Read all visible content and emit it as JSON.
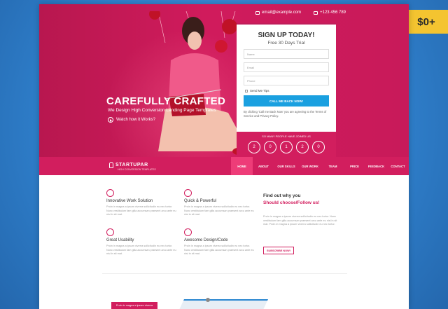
{
  "badge": {
    "price": "$0+",
    "color": "#f4c430"
  },
  "hero": {
    "email": "email@example.com",
    "phone": "+123 456 789",
    "title": "CAREFULLY CRAFTED",
    "subtitle": "We Design High Conversion Landing Page Templates",
    "watch": "Watch how it Works?",
    "accent": "#d21e5e"
  },
  "signup": {
    "title": "SIGN UP TODAY!",
    "subtitle": "Free 30 Days Trial",
    "name_placeholder": "Name",
    "email_placeholder": "Email",
    "phone_placeholder": "Phone",
    "checkbox_label": "Send Me Tips",
    "cta": "CALL ME BACK NOW!",
    "terms": "By clicking 'Call me Back Now' you are agreeing to the Terms of Service and Privacy Policy.",
    "joined_title": "SO MANY PEOPLE HAVE JOINED US",
    "counters": [
      "2",
      "0",
      "1",
      "2",
      "0"
    ]
  },
  "nav": {
    "logo": "STARTUPAR",
    "tagline": "HIGH CONVERSION TEMPLATES",
    "items": [
      "HOME",
      "ABOUT",
      "OUR SKILLS",
      "OUR WORK",
      "TEAM",
      "PRICE",
      "FEEDBACK",
      "CONTACT"
    ]
  },
  "features": {
    "items": [
      {
        "title": "Innovative Work Solution",
        "text": "Proin in magna a ipsum viverra sollicitudin eu nec tortor. Nunc vestibulum fam gilla accumsan praesent arcu ante eu nisi in sit mat."
      },
      {
        "title": "Quick & Powerful",
        "text": "Proin in magna a ipsum viverra sollicitudin eu nec tortor. Nunc vestibulum fam gilla accumsan praesent arcu ante eu nisi in sit mat."
      },
      {
        "title": "Great Usability",
        "text": "Proin in magna a ipsum viverra sollicitudin eu nec tortor. Nunc vestibulum fam gilla accumsan praesent arcu ante eu nisi in sit mat."
      },
      {
        "title": "Awesome Design/Code",
        "text": "Proin in magna a ipsum viverra sollicitudin eu nec tortor. Nunc vestibulum fam gilla accumsan praesent arcu ante eu nisi in sit mat."
      }
    ],
    "why_line1": "Find out why you",
    "why_line2": "Should choose/Follow us!",
    "why_text": "Proin in magna a ipsum viverra sollicitudin eu nec tortor. Nunc vestibulum fam gilla accumsan praesent arcu ante eu nisi in sit mat. Proin in magna a ipsum viverra sollicitudin eu nec tortor.",
    "subscribe": "SUBSCRIBE NOW!"
  },
  "lower": {
    "button": "Proin in magna a ipsum viverra"
  }
}
